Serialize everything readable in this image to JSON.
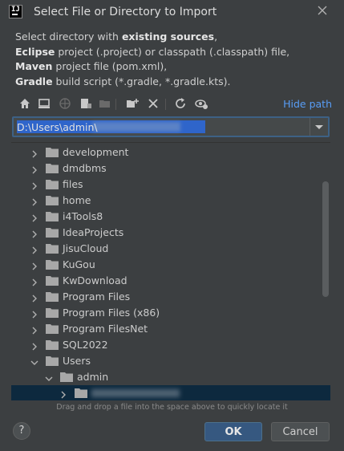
{
  "window": {
    "title": "Select File or Directory to Import",
    "app_icon_text": "IJ"
  },
  "description": {
    "line1_pre": "Select directory with ",
    "line1_bold": "existing sources",
    "line1_post": ",",
    "line2_bold": "Eclipse",
    "line2_post": " project (.project) or classpath (.classpath) file,",
    "line3_bold": "Maven",
    "line3_post": " project file (pom.xml),",
    "line4_bold": "Gradle",
    "line4_post": " build script (*.gradle, *.gradle.kts)."
  },
  "toolbar": {
    "icons": [
      "home-icon",
      "desktop-icon",
      "project-icon",
      "module-icon",
      "module-folder-icon",
      "new-folder-icon",
      "delete-icon",
      "refresh-icon",
      "show-hidden-icon"
    ],
    "hide_path_label": "Hide path"
  },
  "path": {
    "value": "D:\\Users\\admin\\"
  },
  "tree": {
    "items": [
      {
        "label": "development",
        "level": 1,
        "expanded": false
      },
      {
        "label": "dmdbms",
        "level": 1,
        "expanded": false
      },
      {
        "label": "files",
        "level": 1,
        "expanded": false
      },
      {
        "label": "home",
        "level": 1,
        "expanded": false
      },
      {
        "label": "i4Tools8",
        "level": 1,
        "expanded": false
      },
      {
        "label": "IdeaProjects",
        "level": 1,
        "expanded": false
      },
      {
        "label": "JisuCloud",
        "level": 1,
        "expanded": false
      },
      {
        "label": "KuGou",
        "level": 1,
        "expanded": false
      },
      {
        "label": "KwDownload",
        "level": 1,
        "expanded": false
      },
      {
        "label": "Program Files",
        "level": 1,
        "expanded": false
      },
      {
        "label": "Program Files (x86)",
        "level": 1,
        "expanded": false
      },
      {
        "label": "Program FilesNet",
        "level": 1,
        "expanded": false
      },
      {
        "label": "SQL2022",
        "level": 1,
        "expanded": false
      },
      {
        "label": "Users",
        "level": 1,
        "expanded": true
      },
      {
        "label": "admin",
        "level": 2,
        "expanded": true
      },
      {
        "label": "",
        "level": 3,
        "expanded": false,
        "selected": true
      }
    ]
  },
  "hint": "Drag and drop a file into the space above to quickly locate it",
  "buttons": {
    "help": "?",
    "ok": "OK",
    "cancel": "Cancel"
  },
  "colors": {
    "background": "#3c3f41",
    "accent_link": "#589df6",
    "selection": "#2f65ca",
    "selected_row": "#0d293e",
    "ok_button": "#365880"
  }
}
